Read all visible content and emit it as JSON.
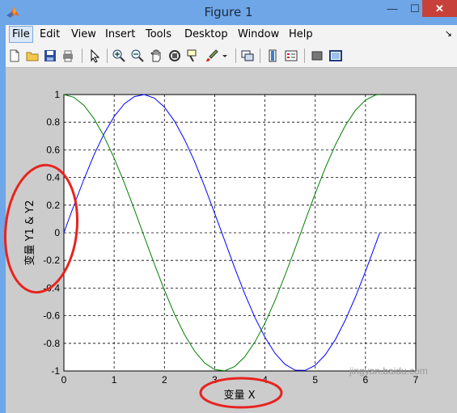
{
  "window": {
    "title": "Figure 1",
    "minimize_glyph": "—",
    "maximize_glyph": "☐",
    "close_glyph": "✕"
  },
  "menu": {
    "items": [
      "File",
      "Edit",
      "View",
      "Insert",
      "Tools",
      "Desktop",
      "Window",
      "Help"
    ],
    "active": "File",
    "dock_arrow": "↘"
  },
  "toolbar": {
    "icons": [
      "new-figure-icon",
      "open-file-icon",
      "save-icon",
      "print-icon",
      "edit-plot-icon",
      "zoom-in-icon",
      "zoom-out-icon",
      "pan-icon",
      "rotate-3d-icon",
      "data-cursor-icon",
      "brush-icon",
      "brush-dropdown-icon",
      "link-plot-icon",
      "insert-colorbar-icon",
      "insert-legend-icon",
      "hide-plot-tools-icon",
      "show-plot-tools-icon"
    ]
  },
  "colors": {
    "series_sin": "#0000ff",
    "series_cos": "#008000",
    "annotation": "#e8231f",
    "figure_bg": "#cccccc"
  },
  "chart_data": {
    "type": "line",
    "title": "",
    "xlabel": "变量 X",
    "ylabel": "变量 Y1 & Y2",
    "xlim": [
      0,
      7
    ],
    "ylim": [
      -1,
      1
    ],
    "xticks": [
      "0",
      "1",
      "2",
      "3",
      "4",
      "5",
      "6",
      "7"
    ],
    "yticks": [
      "1",
      "0.8",
      "0.6",
      "0.4",
      "0.2",
      "0",
      "-0.2",
      "-0.4",
      "-0.6",
      "-0.8",
      "-1"
    ],
    "grid": true,
    "grid_style": "dashed",
    "series": [
      {
        "color": "#0000ff",
        "x": [
          0,
          0.2,
          0.4,
          0.6,
          0.8,
          1.0,
          1.2,
          1.4,
          1.6,
          1.8,
          2.0,
          2.2,
          2.4,
          2.6,
          2.8,
          3.0,
          3.2,
          3.4,
          3.6,
          3.8,
          4.0,
          4.2,
          4.4,
          4.6,
          4.8,
          5.0,
          5.2,
          5.4,
          5.6,
          5.8,
          6.0,
          6.2,
          6.283
        ],
        "y": [
          0,
          0.199,
          0.389,
          0.565,
          0.717,
          0.841,
          0.932,
          0.985,
          1.0,
          0.974,
          0.909,
          0.808,
          0.675,
          0.516,
          0.335,
          0.141,
          -0.058,
          -0.256,
          -0.443,
          -0.612,
          -0.757,
          -0.872,
          -0.952,
          -0.994,
          -0.996,
          -0.959,
          -0.883,
          -0.773,
          -0.631,
          -0.465,
          -0.279,
          -0.083,
          0
        ]
      },
      {
        "color": "#008000",
        "x": [
          0,
          0.2,
          0.4,
          0.6,
          0.8,
          1.0,
          1.2,
          1.4,
          1.6,
          1.8,
          2.0,
          2.2,
          2.4,
          2.6,
          2.8,
          3.0,
          3.2,
          3.4,
          3.6,
          3.8,
          4.0,
          4.2,
          4.4,
          4.6,
          4.8,
          5.0,
          5.2,
          5.4,
          5.6,
          5.8,
          6.0,
          6.2,
          6.283
        ],
        "y": [
          1,
          0.98,
          0.921,
          0.825,
          0.697,
          0.54,
          0.362,
          0.17,
          -0.029,
          -0.227,
          -0.416,
          -0.589,
          -0.737,
          -0.857,
          -0.942,
          -0.99,
          -0.998,
          -0.967,
          -0.897,
          -0.791,
          -0.654,
          -0.49,
          -0.307,
          -0.112,
          0.087,
          0.284,
          0.469,
          0.635,
          0.776,
          0.886,
          0.96,
          0.997,
          1
        ]
      }
    ]
  },
  "watermark": "jingyan.baidu.com"
}
